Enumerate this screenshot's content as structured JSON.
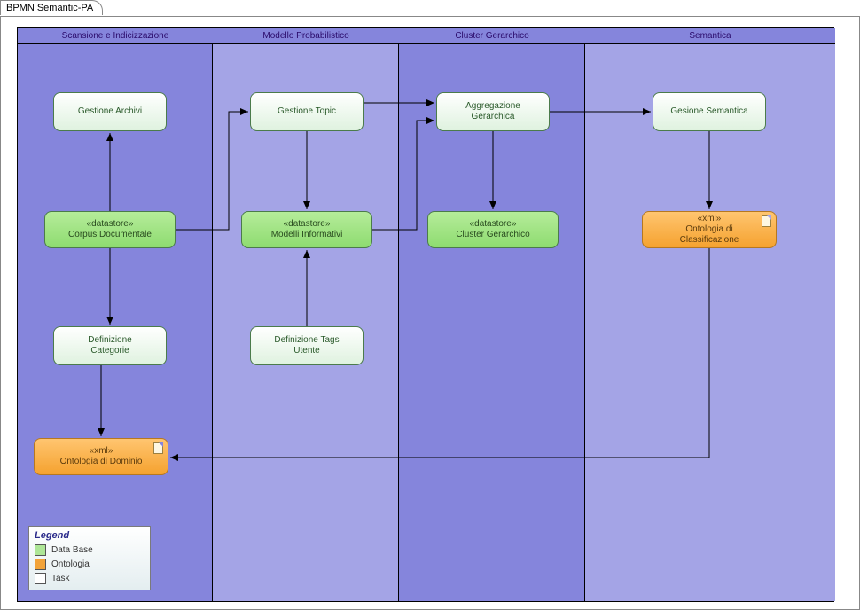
{
  "tab_title": "BPMN Semantic-PA",
  "lanes": {
    "l1": "Scansione e Indicizzazione",
    "l2": "Modello Probabilistico",
    "l3": "Cluster Gerarchico",
    "l4": "Semantica"
  },
  "nodes": {
    "gest_archivi": "Gestione Archivi",
    "corpus_stereo": "«datastore»",
    "corpus_label": "Corpus Documentale",
    "def_categorie_1": "Definizione",
    "def_categorie_2": "Categorie",
    "ont_dom_stereo": "«xml»",
    "ont_dom_label": "Ontologia di Dominio",
    "gest_topic": "Gestione Topic",
    "modelli_stereo": "«datastore»",
    "modelli_label": "Modelli Informativi",
    "def_tags_1": "Definizione Tags",
    "def_tags_2": "Utente",
    "aggreg_1": "Aggregazione",
    "aggreg_2": "Gerarchica",
    "cluster_stereo": "«datastore»",
    "cluster_label": "Cluster Gerarchico",
    "gest_sem": "Gesione Semantica",
    "ont_class_stereo": "«xml»",
    "ont_class_1": "Ontologia di",
    "ont_class_2": "Classificazione"
  },
  "legend": {
    "title": "Legend",
    "db": "Data Base",
    "onto": "Ontologia",
    "task": "Task"
  }
}
